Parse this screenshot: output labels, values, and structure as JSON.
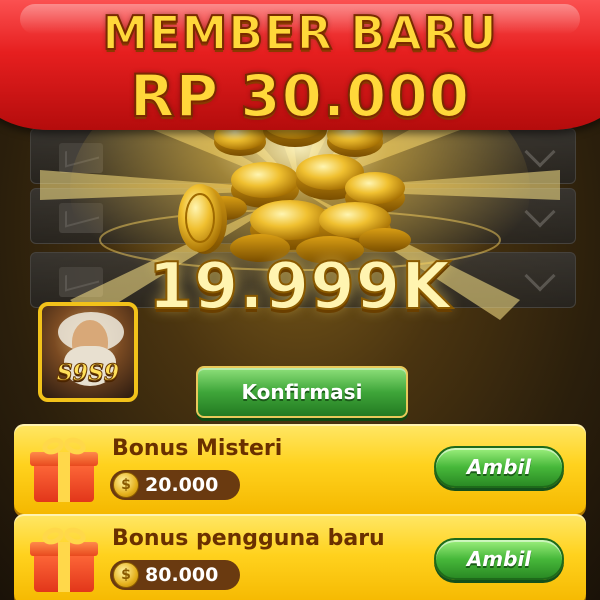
{
  "banner": {
    "line1": "MEMBER BARU",
    "line2": "RP 30.000"
  },
  "reward": {
    "amount": "19.999K"
  },
  "logo": {
    "text": "S9S9"
  },
  "confirm_button": {
    "label": "Konfirmasi"
  },
  "bonuses": [
    {
      "title": "Bonus Misteri",
      "coin_symbol": "$",
      "value": "20.000",
      "button_label": "Ambil"
    },
    {
      "title": "Bonus pengguna baru",
      "coin_symbol": "$",
      "value": "80.000",
      "button_label": "Ambil"
    }
  ],
  "colors": {
    "banner_red": "#e61f1f",
    "gold_text": "#ffd83a",
    "card_yellow": "#ffd21e",
    "button_green": "#3fa63a"
  }
}
